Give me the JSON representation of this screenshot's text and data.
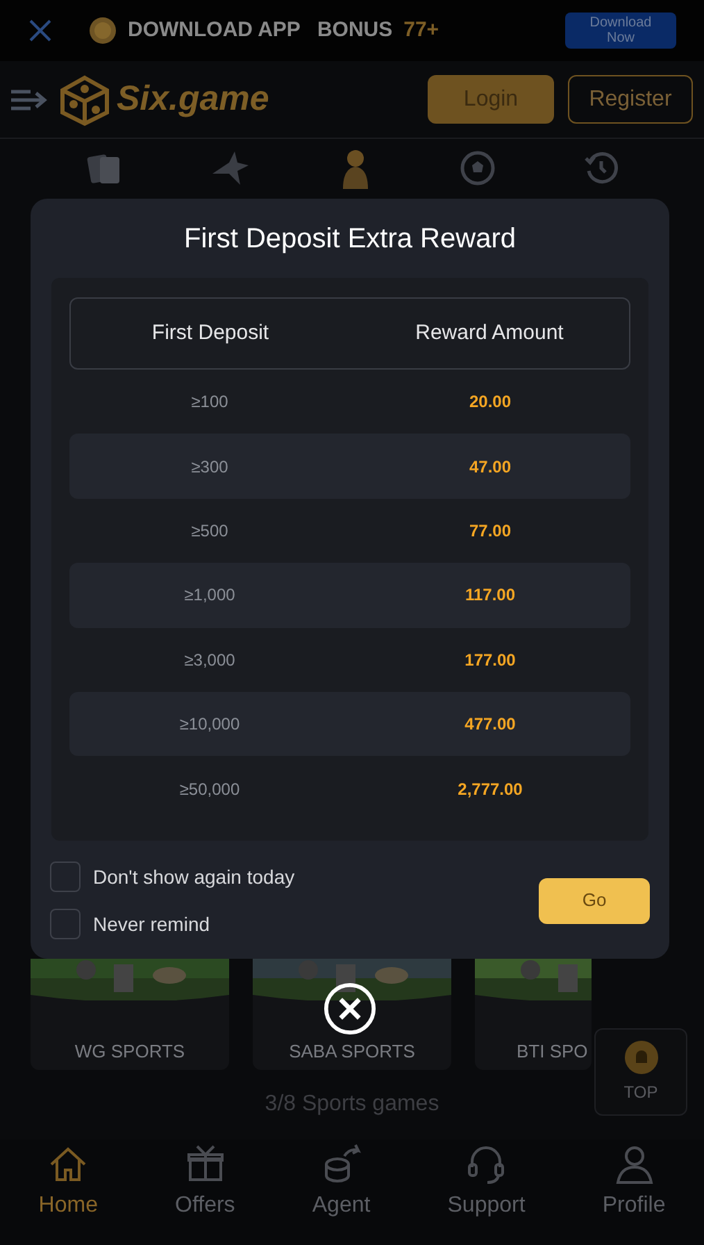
{
  "banner": {
    "headline": "DOWNLOAD APP",
    "bonus_label": "BONUS",
    "bonus_value": "77+",
    "download_button": "Download Now"
  },
  "header": {
    "logo": "Six.game",
    "login_button": "Login",
    "register_button": "Register"
  },
  "modal": {
    "title": "First Deposit Extra Reward",
    "columns": [
      "First Deposit",
      "Reward Amount"
    ],
    "rows": [
      {
        "deposit": "≥100",
        "reward": "20.00"
      },
      {
        "deposit": "≥300",
        "reward": "47.00"
      },
      {
        "deposit": "≥500",
        "reward": "77.00"
      },
      {
        "deposit": "≥1,000",
        "reward": "117.00"
      },
      {
        "deposit": "≥3,000",
        "reward": "177.00"
      },
      {
        "deposit": "≥10,000",
        "reward": "477.00"
      },
      {
        "deposit": "≥50,000",
        "reward": "2,777.00"
      }
    ],
    "options": [
      {
        "label": "Don't show again today",
        "checked": false
      },
      {
        "label": "Never remind",
        "checked": false
      }
    ],
    "go_button": "Go"
  },
  "games": [
    {
      "label": "WG SPORTS"
    },
    {
      "label": "SABA SPORTS"
    },
    {
      "label": "BTI SPO"
    }
  ],
  "games_count": "3/8 Sports games",
  "top_button": "TOP",
  "bottom_nav": [
    {
      "label": "Home",
      "kind": "home",
      "selected": true
    },
    {
      "label": "Offers",
      "kind": "gift",
      "selected": false
    },
    {
      "label": "Agent",
      "kind": "agent",
      "selected": false
    },
    {
      "label": "Support",
      "kind": "headset",
      "selected": false
    },
    {
      "label": "Profile",
      "kind": "person",
      "selected": false
    }
  ]
}
